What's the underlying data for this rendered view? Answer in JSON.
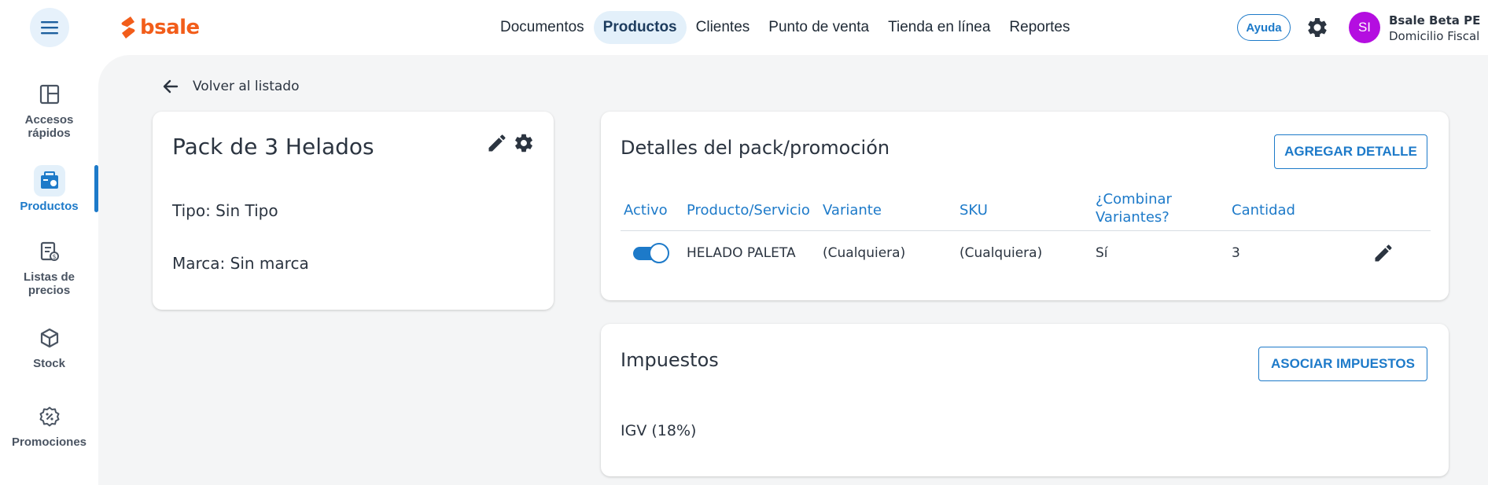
{
  "brand": {
    "name": "bsale",
    "color": "#f25d1a",
    "accent": "#1d7ac9"
  },
  "nav": {
    "items": [
      {
        "label": "Documentos"
      },
      {
        "label": "Productos",
        "active": true
      },
      {
        "label": "Clientes"
      },
      {
        "label": "Punto de venta"
      },
      {
        "label": "Tienda en línea"
      },
      {
        "label": "Reportes"
      }
    ]
  },
  "header": {
    "help_label": "Ayuda",
    "avatar_initials": "SI",
    "avatar_color": "#b40ee0",
    "user_name": "Bsale Beta PE",
    "user_sub": "Domicilio Fiscal"
  },
  "sidebar": {
    "items": [
      {
        "label": "Accesos rápidos",
        "icon": "dashboard-icon"
      },
      {
        "label": "Productos",
        "icon": "products-icon",
        "active": true
      },
      {
        "label": "Listas de precios",
        "icon": "price-list-icon"
      },
      {
        "label": "Stock",
        "icon": "cube-icon"
      },
      {
        "label": "Promociones",
        "icon": "discount-badge-icon"
      }
    ]
  },
  "main": {
    "back_label": "Volver al listado",
    "product": {
      "title": "Pack de 3 Helados",
      "type_line": "Tipo: Sin Tipo",
      "brand_line": "Marca: Sin marca"
    },
    "details": {
      "title": "Detalles del pack/promoción",
      "add_button": "AGREGAR DETALLE",
      "columns": [
        "Activo",
        "Producto/Servicio",
        "Variante",
        "SKU",
        "¿Combinar Variantes?",
        "Cantidad"
      ],
      "rows": [
        {
          "active": true,
          "product": "HELADO PALETA",
          "variant": "(Cualquiera)",
          "sku": "(Cualquiera)",
          "combine": "Sí",
          "quantity": "3"
        }
      ]
    },
    "taxes": {
      "title": "Impuestos",
      "associate_button": "ASOCIAR IMPUESTOS",
      "items": [
        "IGV (18%)"
      ]
    }
  }
}
